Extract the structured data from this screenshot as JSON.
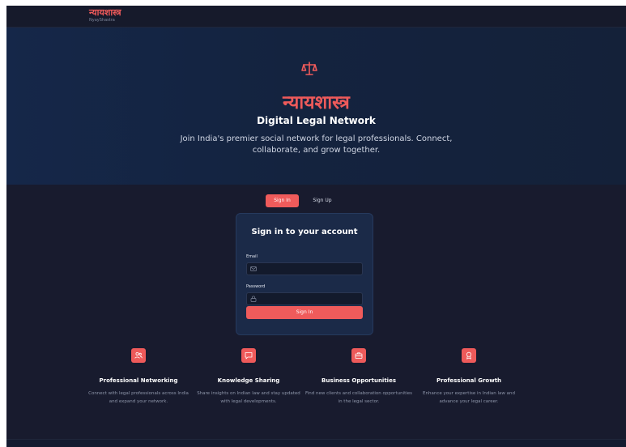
{
  "header": {
    "brand_name": "न्यायशास्त्र",
    "brand_sub": "NyayShastra"
  },
  "hero": {
    "icon": "scale-icon",
    "title": "न्यायशास्त्र",
    "subtitle": "Digital Legal Network",
    "description": "Join India's premier social network for legal professionals. Connect, collaborate, and grow together."
  },
  "auth": {
    "tabs": [
      {
        "label": "Sign In",
        "active": true
      },
      {
        "label": "Sign Up",
        "active": false
      }
    ],
    "card_title": "Sign in to your account",
    "email_label": "Email",
    "email_placeholder": "",
    "password_label": "Password",
    "password_placeholder": "",
    "submit_label": "Sign In"
  },
  "features": [
    {
      "icon": "users-icon",
      "title": "Professional Networking",
      "description": "Connect with legal professionals across India and expand your network."
    },
    {
      "icon": "chat-icon",
      "title": "Knowledge Sharing",
      "description": "Share insights on Indian law and stay updated with legal developments."
    },
    {
      "icon": "briefcase-icon",
      "title": "Business Opportunities",
      "description": "Find new clients and collaboration opportunities in the legal sector."
    },
    {
      "icon": "award-icon",
      "title": "Professional Growth",
      "description": "Enhance your expertise in Indian law and advance your legal career."
    }
  ],
  "colors": {
    "accent": "#ef5b5b",
    "background": "#181b2e",
    "hero_background": "#152749",
    "card_background": "#1b2a48"
  }
}
